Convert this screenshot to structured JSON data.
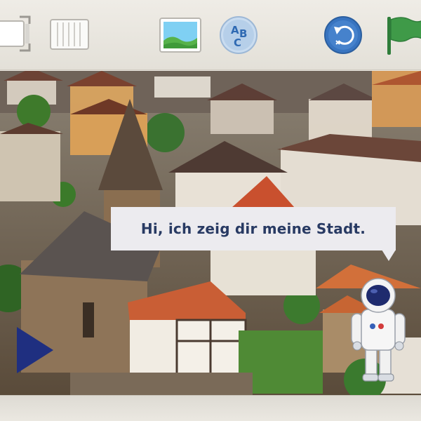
{
  "toolbar": {
    "buttons": [
      {
        "id": "frame",
        "icon": "frame-icon"
      },
      {
        "id": "page",
        "icon": "page-grid-icon"
      },
      {
        "id": "image",
        "icon": "landscape-image-icon"
      },
      {
        "id": "abc",
        "icon": "abc-letters-icon",
        "letters": [
          "A",
          "B",
          "C"
        ]
      },
      {
        "id": "undo",
        "icon": "undo-arrow-icon"
      },
      {
        "id": "flag",
        "icon": "green-flag-icon"
      }
    ]
  },
  "scene": {
    "speech_bubble": {
      "text": "Hi, ich zeig dir meine Stadt."
    },
    "navigation": {
      "prev_icon": "triangle-left-icon"
    },
    "character": "astronaut"
  },
  "colors": {
    "toolbar_bg": "#ebe8e1",
    "speech_text": "#283a63",
    "accent_blue": "#2f6ab3",
    "flag_green": "#3f9a48",
    "nav_arrow": "#1f2f80"
  }
}
